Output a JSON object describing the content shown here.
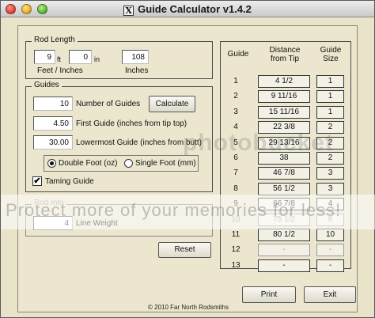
{
  "window": {
    "title": "Guide Calculator v1.4.2",
    "icon": "x-icon"
  },
  "rod_length": {
    "title": "Rod Length",
    "feet": "9",
    "feet_unit": "ft",
    "inches": "0",
    "inches_unit": "in",
    "feet_inches_label": "Feet / Inches",
    "total_inches": "108",
    "total_label": "Inches"
  },
  "guides": {
    "title": "Guides",
    "number": "10",
    "number_label": "Number of Guides",
    "calculate_label": "Calculate",
    "first_guide": "4.50",
    "first_guide_label": "First Guide (inches from tip top)",
    "lowermost": "30.00",
    "lowermost_label": "Lowermost Guide (inches from butt)",
    "radio_double": "Double Foot (oz)",
    "radio_single": "Single Foot (mm)",
    "taming_label": "Taming Guide",
    "taming_checked": "✔"
  },
  "rod_info": {
    "title": "Rod Info",
    "line_weight": "4",
    "line_weight_label": "Line Weight"
  },
  "reset_label": "Reset",
  "table": {
    "col_guide": "Guide",
    "col_distance_1": "Distance",
    "col_distance_2": "from Tip",
    "col_size_1": "Guide",
    "col_size_2": "Size",
    "rows": [
      {
        "n": "1",
        "d": "4 1/2",
        "s": "1"
      },
      {
        "n": "2",
        "d": "9 11/16",
        "s": "1"
      },
      {
        "n": "3",
        "d": "15 11/16",
        "s": "1"
      },
      {
        "n": "4",
        "d": "22 3/8",
        "s": "2"
      },
      {
        "n": "5",
        "d": "29 13/16",
        "s": "2"
      },
      {
        "n": "6",
        "d": "38",
        "s": "2"
      },
      {
        "n": "7",
        "d": "46 7/8",
        "s": "3"
      },
      {
        "n": "8",
        "d": "56 1/2",
        "s": "3"
      },
      {
        "n": "9",
        "d": "66 7/8",
        "s": "4"
      },
      {
        "n": "10",
        "d": "75 1/2",
        "s": "8"
      },
      {
        "n": "11",
        "d": "80 1/2",
        "s": "10"
      },
      {
        "n": "12",
        "d": "-",
        "s": "-"
      },
      {
        "n": "13",
        "d": "-",
        "s": "-"
      }
    ]
  },
  "print_label": "Print",
  "exit_label": "Exit",
  "copyright": "© 2010 Far North Rodsmiths",
  "watermark": "Protect more of your memories for less!",
  "watermark_logo": "photobucket"
}
